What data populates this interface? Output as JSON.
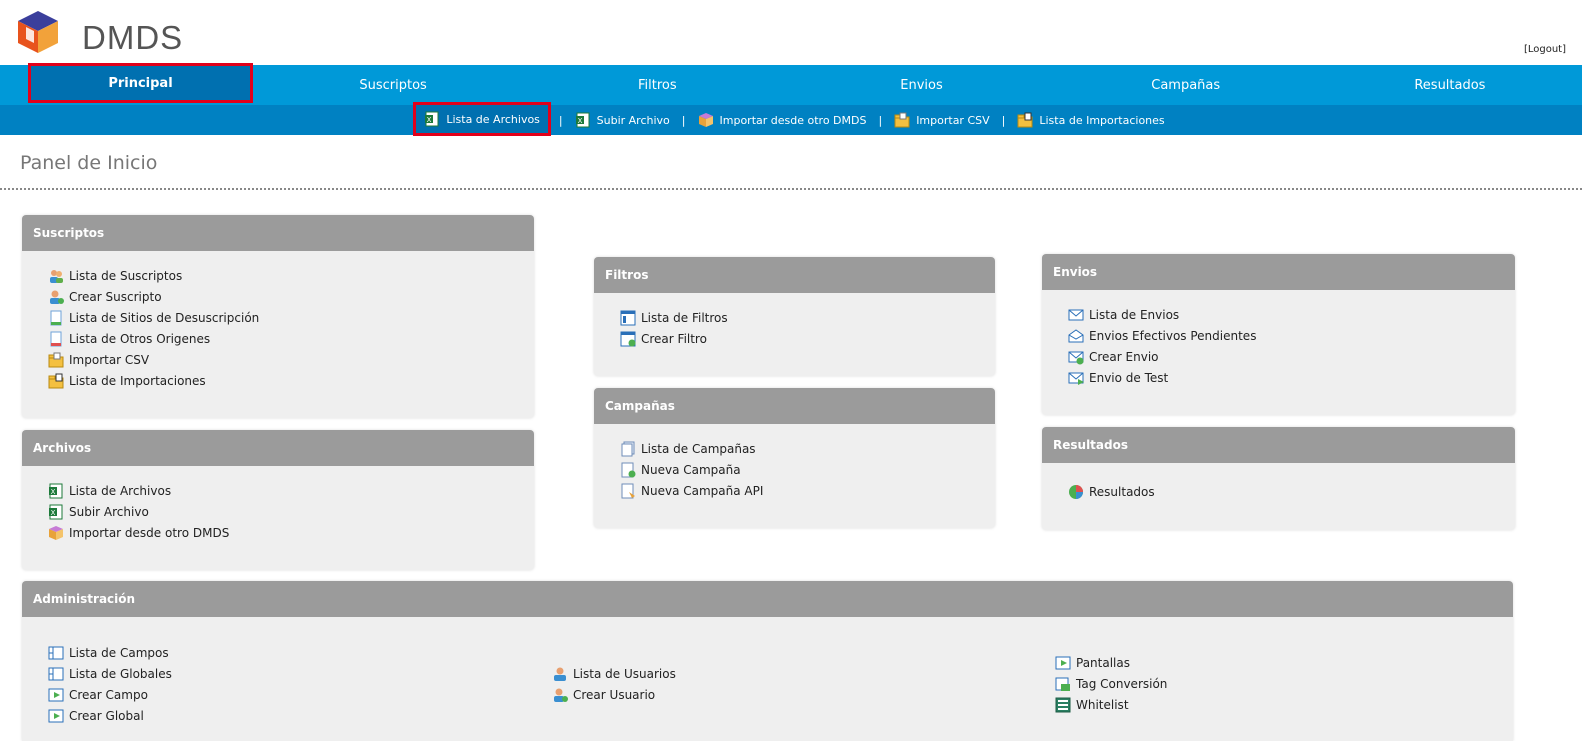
{
  "brand": {
    "name": "DMDS"
  },
  "header": {
    "logout": "[Logout]"
  },
  "nav": {
    "items": [
      {
        "label": "Principal",
        "active": true
      },
      {
        "label": "Suscriptos"
      },
      {
        "label": "Filtros"
      },
      {
        "label": "Envios"
      },
      {
        "label": "Campañas"
      },
      {
        "label": "Resultados"
      }
    ]
  },
  "subnav": {
    "items": [
      {
        "label": "Lista de Archivos",
        "icon": "excel-icon",
        "active": true
      },
      {
        "label": "Subir Archivo",
        "icon": "excel-upload-icon"
      },
      {
        "label": "Importar desde otro DMDS",
        "icon": "box-icon"
      },
      {
        "label": "Importar CSV",
        "icon": "folder-import-icon"
      },
      {
        "label": "Lista de Importaciones",
        "icon": "folder-list-icon"
      }
    ],
    "separator": "|"
  },
  "page": {
    "title": "Panel de Inicio"
  },
  "panels": {
    "suscriptos": {
      "title": "Suscriptos",
      "links": [
        "Lista de Suscriptos",
        "Crear Suscripto",
        "Lista de Sitios de Desuscripción",
        "Lista de Otros Origenes",
        "Importar CSV",
        "Lista de Importaciones"
      ]
    },
    "archivos": {
      "title": "Archivos",
      "links": [
        "Lista de Archivos",
        "Subir Archivo",
        "Importar desde otro DMDS"
      ]
    },
    "filtros": {
      "title": "Filtros",
      "links": [
        "Lista de Filtros",
        "Crear Filtro"
      ]
    },
    "campanas": {
      "title": "Campañas",
      "links": [
        "Lista de Campañas",
        "Nueva Campaña",
        "Nueva Campaña API"
      ]
    },
    "envios": {
      "title": "Envios",
      "links": [
        "Lista de Envios",
        "Envios Efectivos Pendientes",
        "Crear Envio",
        "Envio de Test"
      ]
    },
    "resultados": {
      "title": "Resultados",
      "links": [
        "Resultados"
      ]
    },
    "administracion": {
      "title": "Administración",
      "col1": [
        "Lista de Campos",
        "Lista de Globales",
        "Crear Campo",
        "Crear Global"
      ],
      "col2": [
        "Lista de Usuarios",
        "Crear Usuario"
      ],
      "col3": [
        "Pantallas",
        "Tag Conversión",
        "Whitelist"
      ]
    }
  },
  "colors": {
    "nav": "#0099d8",
    "subnav": "#0081c2",
    "active": "#0070b0",
    "highlight": "#e2001a",
    "panel_head": "#9b9b9b",
    "panel_bg": "#efefef"
  }
}
